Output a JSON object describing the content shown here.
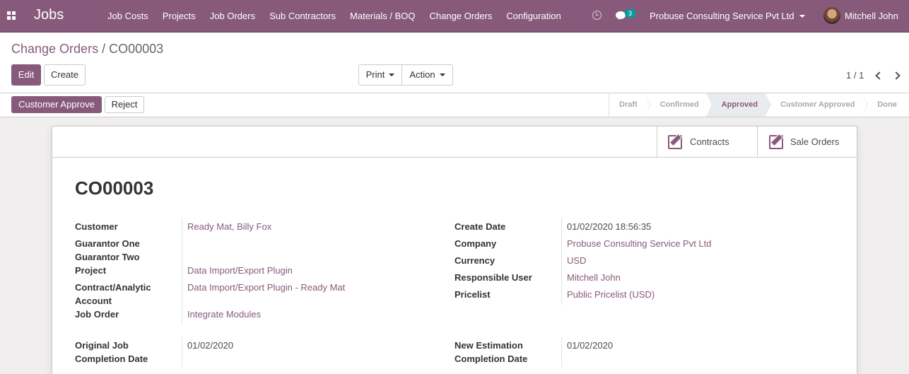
{
  "navbar": {
    "brand": "Jobs",
    "menu": [
      "Job Costs",
      "Projects",
      "Job Orders",
      "Sub Contractors",
      "Materials / BOQ",
      "Change Orders",
      "Configuration"
    ],
    "chat_count": "3",
    "company": "Probuse Consulting Service Pvt Ltd",
    "user": "Mitchell John",
    "accent": "#875a7b"
  },
  "breadcrumb": {
    "parent": "Change Orders",
    "separator": "/",
    "current": "CO00003"
  },
  "buttons": {
    "edit": "Edit",
    "create": "Create",
    "print": "Print",
    "action": "Action",
    "customer_approve": "Customer Approve",
    "reject": "Reject"
  },
  "pager": {
    "text": "1 / 1"
  },
  "statusbar": {
    "steps": [
      "Draft",
      "Confirmed",
      "Approved",
      "Customer Approved",
      "Done"
    ],
    "active": "Approved"
  },
  "smart_buttons": {
    "contracts": "Contracts",
    "sale_orders": "Sale Orders"
  },
  "record": {
    "name": "CO00003",
    "left": {
      "customer_label": "Customer",
      "customer_value": "Ready Mat, Billy Fox",
      "guarantor_one_label": "Guarantor One",
      "guarantor_two_label": "Guarantor Two",
      "project_label": "Project",
      "project_value": "Data Import/Export Plugin",
      "contract_label_1": "Contract/Analytic",
      "contract_label_2": "Account",
      "contract_value": "Data Import/Export Plugin - Ready Mat",
      "job_order_label": "Job Order",
      "job_order_value": "Integrate Modules",
      "orig_label_1": "Original Job",
      "orig_label_2": "Completion Date",
      "orig_value": "01/02/2020"
    },
    "right": {
      "create_date_label": "Create Date",
      "create_date_value": "01/02/2020 18:56:35",
      "company_label": "Company",
      "company_value": "Probuse Consulting Service Pvt Ltd",
      "currency_label": "Currency",
      "currency_value": "USD",
      "responsible_label": "Responsible User",
      "responsible_value": "Mitchell John",
      "pricelist_label": "Pricelist",
      "pricelist_value": "Public Pricelist (USD)",
      "new_est_label_1": "New Estimation",
      "new_est_label_2": "Completion Date",
      "new_est_value": "01/02/2020"
    }
  }
}
